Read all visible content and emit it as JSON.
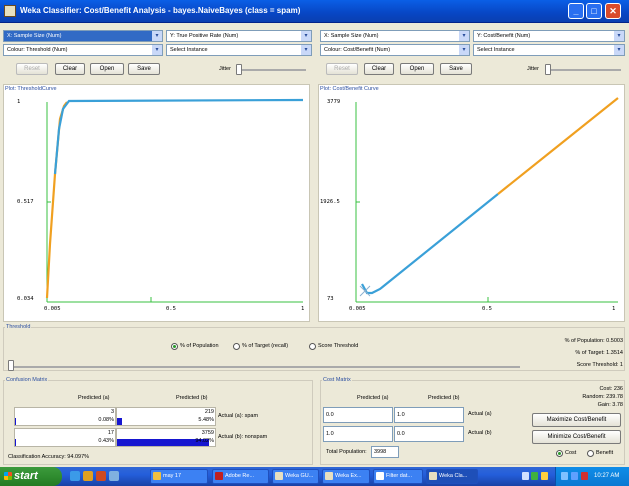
{
  "window": {
    "title": "Weka Classifier: Cost/Benefit Analysis - bayes.NaiveBayes (class = spam)",
    "min": "_",
    "max": "□",
    "close": "✕"
  },
  "left": {
    "x_combo": "X: Sample Size (Num)",
    "y_combo": "Y: True Positive Rate (Num)",
    "colour_combo": "Colour: Threshold (Num)",
    "instance_combo": "Select Instance",
    "reset": "Reset",
    "clear": "Clear",
    "open": "Open",
    "save": "Save",
    "jitter": "Jitter",
    "plot_title": "Plot: ThresholdCurve",
    "y_ticks": [
      "1",
      "0.517",
      "0.034"
    ],
    "x_ticks": [
      "0.005",
      "0.5",
      "1"
    ]
  },
  "right": {
    "x_combo": "X: Sample Size (Num)",
    "y_combo": "Y: Cost/Benefit (Num)",
    "colour_combo": "Colour: Cost/Benefit (Num)",
    "instance_combo": "Select Instance",
    "reset": "Reset",
    "clear": "Clear",
    "open": "Open",
    "save": "Save",
    "jitter": "Jitter",
    "plot_title": "Plot: Cost/Benefit Curve",
    "y_ticks": [
      "3779",
      "1926.5",
      "73"
    ],
    "x_ticks": [
      "0.005",
      "0.5",
      "1"
    ]
  },
  "threshold": {
    "title": "Threshold",
    "opt_population": "% of Population",
    "opt_target": "% of Target (recall)",
    "opt_score": "Score Threshold",
    "selected": "% of Population",
    "pct_population": "% of Population: 0.5003",
    "pct_target": "% of Target: 1.3514",
    "score_threshold": "Score Threshold: 1"
  },
  "confusion": {
    "title": "Confusion Matrix",
    "pred_a": "Predicted (a)",
    "pred_b": "Predicted (b)",
    "r1c1_count": "3",
    "r1c1_pct": "0.08%",
    "r1c2_count": "219",
    "r1c2_pct": "5.48%",
    "r1_label": "Actual (a): spam",
    "r2c1_count": "17",
    "r2c1_pct": "0.43%",
    "r2c2_count": "3759",
    "r2c2_pct": "94.02%",
    "r2_label": "Actual (b): nonspam",
    "accuracy": "Classification Accuracy: 94.097%",
    "bar_fill": {
      "r1c1": 0.0008,
      "r1c2": 0.0548,
      "r2c1": 0.0043,
      "r2c2": 0.9402
    }
  },
  "cost": {
    "title": "Cost Matrix",
    "pred_a": "Predicted (a)",
    "pred_b": "Predicted (b)",
    "r1c1": "0.0",
    "r1c2": "1.0",
    "r2c1": "1.0",
    "r2c2": "0.0",
    "r1_label": "Actual (a)",
    "r2_label": "Actual (b)",
    "total_label": "Total Population:",
    "total_value": "3998",
    "cost_value": "Cost: 236",
    "random_value": "Random: 239.78",
    "gain_value": "Gain: 3.78",
    "maximize": "Maximize Cost/Benefit",
    "minimize": "Minimize Cost/Benefit",
    "opt_cost": "Cost",
    "opt_benefit": "Benefit",
    "selected": "Cost"
  },
  "taskbar": {
    "start": "start",
    "tasks": [
      "may 17",
      "Adobe Re...",
      "Weka GU...",
      "Weka Ex...",
      "Filter dat...",
      "Weka Cla..."
    ],
    "clock": "10:27 AM"
  },
  "colors": {
    "titlebar": "#0a5fe6",
    "curve_orange": "#f0a020",
    "curve_blue": "#3aa0d8",
    "axis": "#39c040",
    "bar": "#1616d0"
  }
}
